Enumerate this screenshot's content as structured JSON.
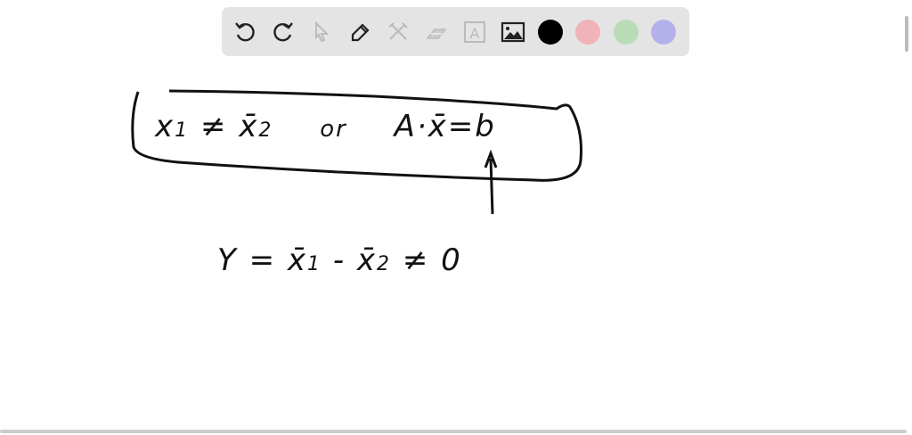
{
  "toolbar": {
    "tools": [
      {
        "name": "undo-icon",
        "enabled": true
      },
      {
        "name": "redo-icon",
        "enabled": true
      },
      {
        "name": "select-icon",
        "enabled": false
      },
      {
        "name": "pen-icon",
        "enabled": true
      },
      {
        "name": "tools-icon",
        "enabled": false
      },
      {
        "name": "eraser-icon",
        "enabled": false
      },
      {
        "name": "text-icon",
        "enabled": false
      },
      {
        "name": "image-icon",
        "enabled": true
      }
    ],
    "text_tool_glyph": "A",
    "colors": [
      "#000000",
      "#f0b4b8",
      "#b8dcb8",
      "#b4b0ec"
    ]
  },
  "canvas": {
    "line1": {
      "x1": "x",
      "s1": "1",
      "neq": "≠",
      "x2": "x̄",
      "s2": "2",
      "or": "or",
      "rhs": "A·x̄=b"
    },
    "line2": {
      "lhs": "Y = x̄",
      "s1": "1",
      "minus": "- x̄",
      "s2": "2",
      "tail": "≠ 0"
    }
  }
}
